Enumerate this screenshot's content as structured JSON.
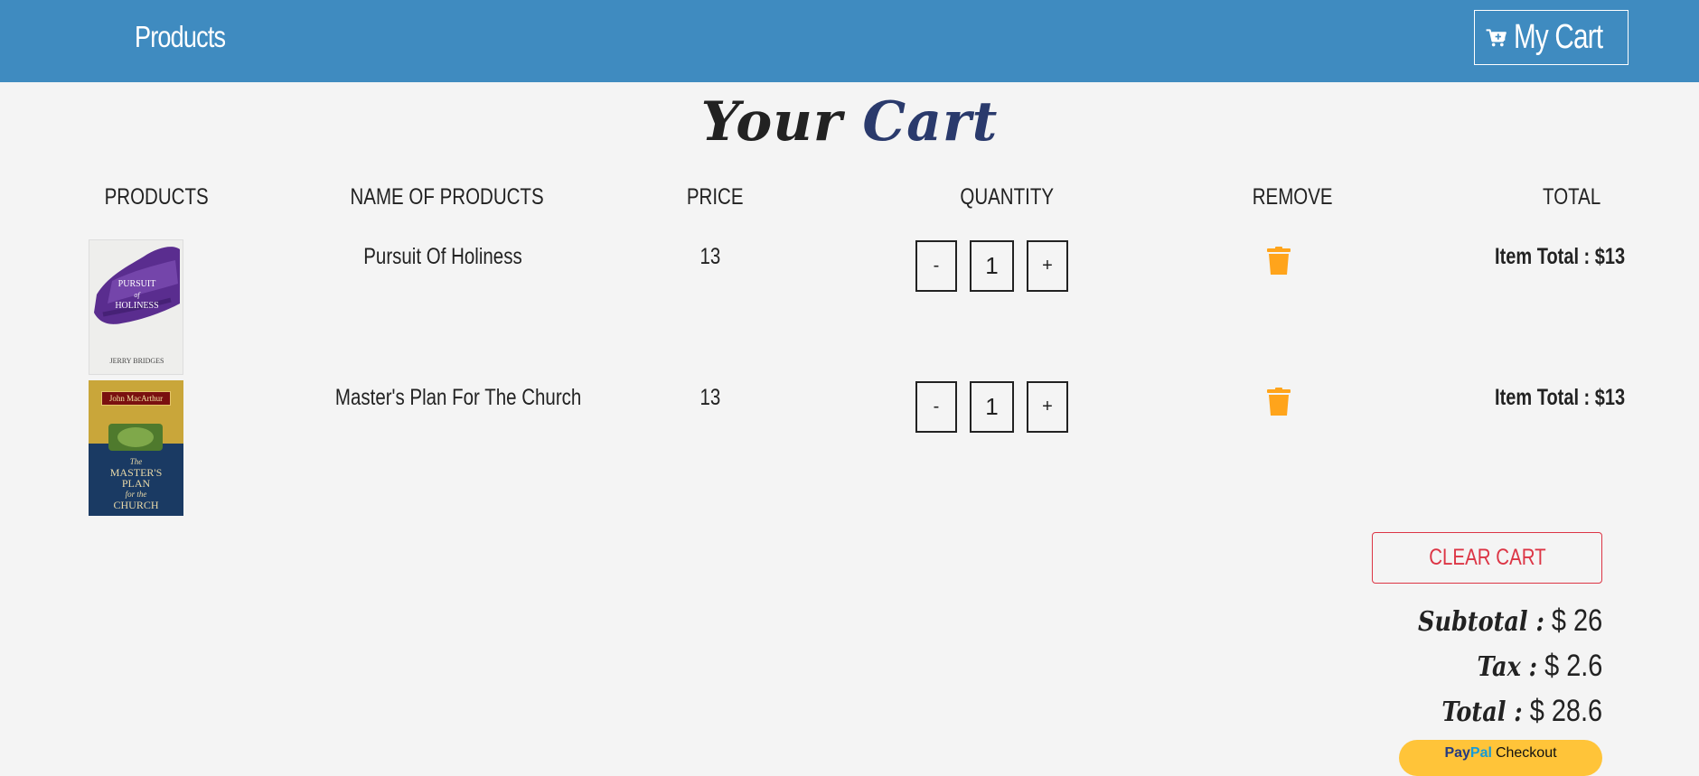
{
  "navbar": {
    "brand": "Products",
    "cart_label": "My Cart",
    "cart_icon": "cart-plus-icon",
    "bg_color": "#3f8bc0"
  },
  "page_title": {
    "word1": "Your",
    "word2": "Cart"
  },
  "table": {
    "headers": [
      "Products",
      "Name of Products",
      "Price",
      "Quantity",
      "Remove",
      "Total"
    ],
    "rows": [
      {
        "name": "Pursuit Of Holiness",
        "price": "13",
        "quantity": "1",
        "minus": "-",
        "plus": "+",
        "item_total": "Item Total : $13",
        "remove_icon": "trash-icon",
        "cover": {
          "title_line1": "PURSUIT",
          "title_line2": "of",
          "title_line3": "HOLINESS",
          "author": "JERRY BRIDGES"
        }
      },
      {
        "name": "Master's Plan For The Church",
        "price": "13",
        "quantity": "1",
        "minus": "-",
        "plus": "+",
        "item_total": "Item Total : $13",
        "remove_icon": "trash-icon",
        "cover": {
          "author": "John MacArthur",
          "title_line1": "The",
          "title_line2": "MASTER'S",
          "title_line3": "PLAN",
          "title_line4": "for the",
          "title_line5": "CHURCH"
        }
      }
    ]
  },
  "summary": {
    "clear_label": "Clear Cart",
    "subtotal_label": "Subtotal :",
    "subtotal_value": "$ 26",
    "tax_label": "Tax :",
    "tax_value": "$ 2.6",
    "total_label": "Total :",
    "total_value": "$ 28.6"
  },
  "paypal": {
    "pay": "Pay",
    "pal": "Pal",
    "checkout": "Checkout"
  },
  "colors": {
    "accent": "#3f8bc0",
    "title_dark": "#2a3a6c",
    "trash": "#ffa41b",
    "danger": "#dc3545",
    "paypal": "#ffc439"
  }
}
